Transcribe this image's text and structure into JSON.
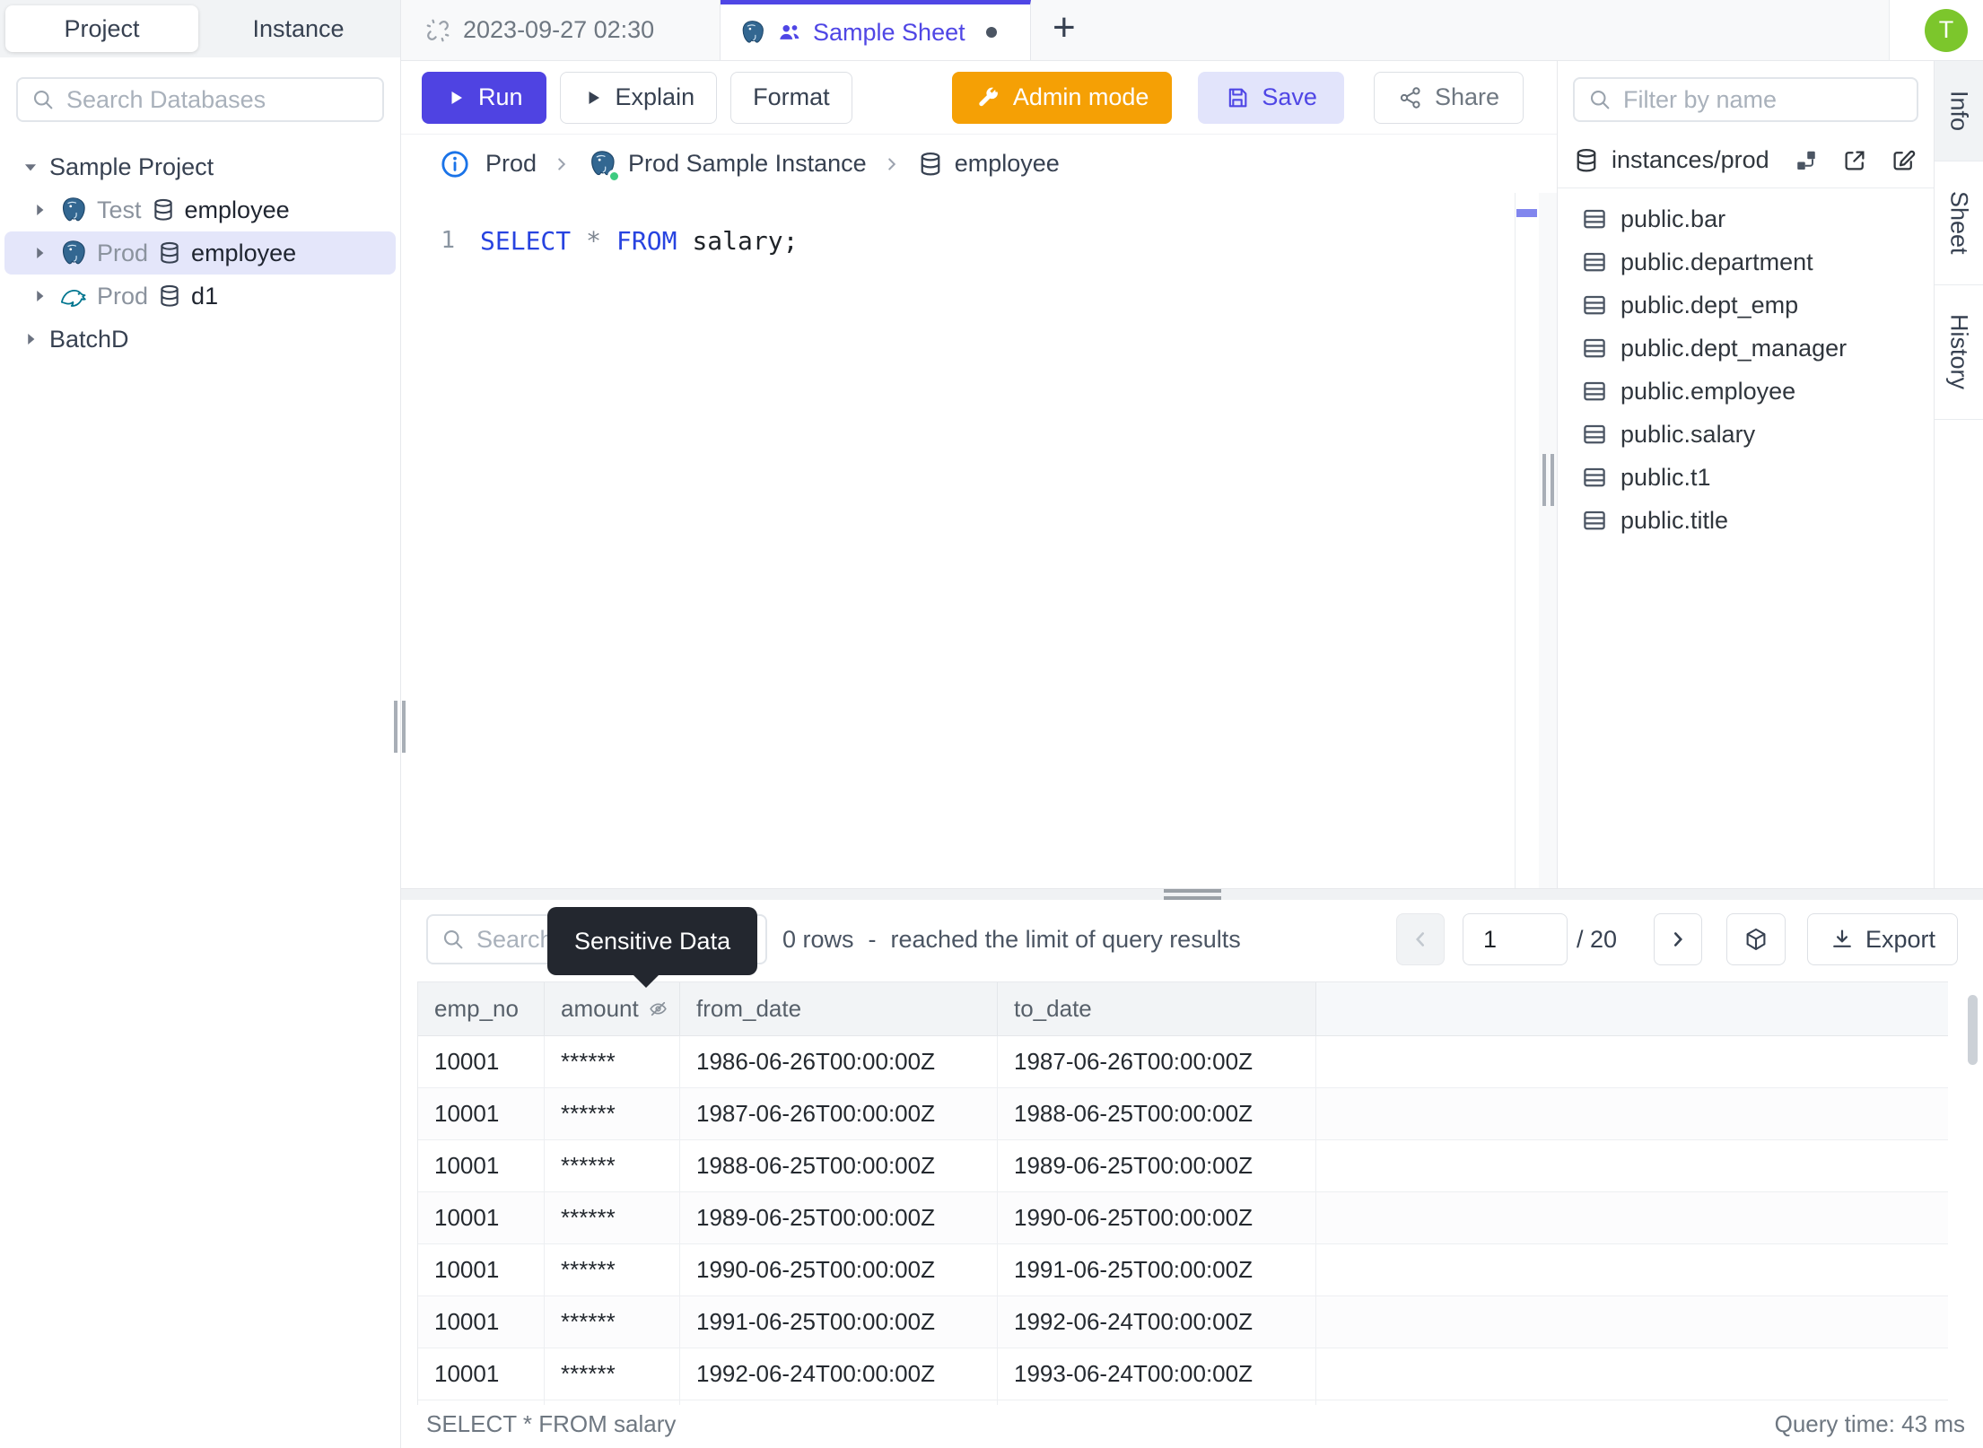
{
  "app": {
    "avatar_initial": "T"
  },
  "colors": {
    "accent": "#4f46e5",
    "admin_orange": "#f5a005",
    "avatar_green": "#7cc62c",
    "status_green": "#3ecb80",
    "keyword_blue": "#2743e0",
    "selected_row": "#e4e6fa"
  },
  "sidebar": {
    "mode_tabs": [
      {
        "label": "Project"
      },
      {
        "label": "Instance"
      }
    ],
    "search_placeholder": "Search Databases",
    "tree": {
      "project": "Sample Project",
      "items": [
        {
          "engine": "postgres",
          "env": "Test",
          "db": "employee",
          "selected": false
        },
        {
          "engine": "postgres",
          "env": "Prod",
          "db": "employee",
          "selected": true
        },
        {
          "engine": "mysql",
          "env": "Prod",
          "db": "d1",
          "selected": false
        }
      ],
      "batch": "BatchD"
    }
  },
  "tabbar": {
    "tabs": [
      {
        "label": "2023-09-27 02:30",
        "active": false
      },
      {
        "label": "Sample Sheet",
        "active": true,
        "unsaved": true
      }
    ],
    "new_tab": "+"
  },
  "toolbar": {
    "run": "Run",
    "explain": "Explain",
    "format": "Format",
    "admin": "Admin mode",
    "save": "Save",
    "share": "Share"
  },
  "breadcrumb": {
    "env": "Prod",
    "instance": "Prod Sample Instance",
    "database": "employee"
  },
  "editor": {
    "line_number": "1",
    "sql": {
      "k1": "SELECT",
      "star": "*",
      "k2": "FROM",
      "rest": "salary;"
    }
  },
  "schema_panel": {
    "filter_placeholder": "Filter by name",
    "header": "instances/prod",
    "tables": [
      "public.bar",
      "public.department",
      "public.dept_emp",
      "public.dept_manager",
      "public.employee",
      "public.salary",
      "public.t1",
      "public.title"
    ]
  },
  "side_tabs": [
    "Info",
    "Sheet",
    "History"
  ],
  "results": {
    "search_placeholder": "Search",
    "tooltip": "Sensitive Data",
    "rows_info": {
      "count": "0 rows",
      "dash": "-",
      "note": "reached the limit of query results"
    },
    "pagination": {
      "page": "1",
      "total": "/ 20"
    },
    "export_label": "Export",
    "table": {
      "columns": [
        {
          "label": "emp_no"
        },
        {
          "label": "amount",
          "masked": true
        },
        {
          "label": "from_date"
        },
        {
          "label": "to_date"
        },
        {
          "label": ""
        }
      ],
      "rows": [
        [
          "10001",
          "******",
          "1986-06-26T00:00:00Z",
          "1987-06-26T00:00:00Z"
        ],
        [
          "10001",
          "******",
          "1987-06-26T00:00:00Z",
          "1988-06-25T00:00:00Z"
        ],
        [
          "10001",
          "******",
          "1988-06-25T00:00:00Z",
          "1989-06-25T00:00:00Z"
        ],
        [
          "10001",
          "******",
          "1989-06-25T00:00:00Z",
          "1990-06-25T00:00:00Z"
        ],
        [
          "10001",
          "******",
          "1990-06-25T00:00:00Z",
          "1991-06-25T00:00:00Z"
        ],
        [
          "10001",
          "******",
          "1991-06-25T00:00:00Z",
          "1992-06-24T00:00:00Z"
        ],
        [
          "10001",
          "******",
          "1992-06-24T00:00:00Z",
          "1993-06-24T00:00:00Z"
        ]
      ]
    },
    "status": {
      "query": "SELECT * FROM salary",
      "time": "Query time: 43 ms"
    }
  }
}
